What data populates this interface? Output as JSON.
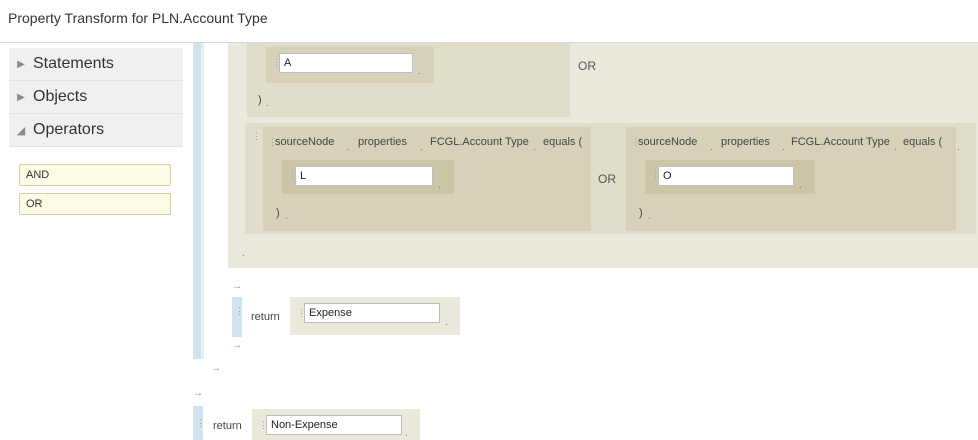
{
  "window": {
    "title": "Property Transform for PLN.Account Type"
  },
  "palette": {
    "items": [
      {
        "label": "Statements",
        "expanded": false
      },
      {
        "label": "Objects",
        "expanded": false
      },
      {
        "label": "Operators",
        "expanded": true
      }
    ],
    "operators": [
      "AND",
      "OR"
    ]
  },
  "canvas": {
    "first_group": {
      "value": "A",
      "or_label": "OR",
      "close_paren": ")"
    },
    "second_group": {
      "left": {
        "tokens": [
          "sourceNode",
          "properties",
          "FCGL.Account Type",
          "equals ("
        ],
        "value": "L",
        "close_paren": ")"
      },
      "or_label": "OR",
      "right": {
        "tokens": [
          "sourceNode",
          "properties",
          "FCGL.Account Type",
          "equals ("
        ],
        "value": "O",
        "close_paren": ")"
      }
    },
    "inner_return": {
      "keyword": "return",
      "value": "Expense"
    },
    "outer_return": {
      "keyword": "return",
      "value": "Non-Expense"
    }
  },
  "colors": {
    "rail": "#cfe4ef",
    "block_outer": "#ebe9dc",
    "block_inner": "#d6d2ba",
    "operator_chip": "#fdfbe5",
    "arrow": "#5a9cc5"
  },
  "icons": {
    "collapsed": "triangle-right-icon",
    "expanded": "triangle-down-icon",
    "grip": "drag-handle-icon",
    "connector": "arrow-right-icon"
  }
}
